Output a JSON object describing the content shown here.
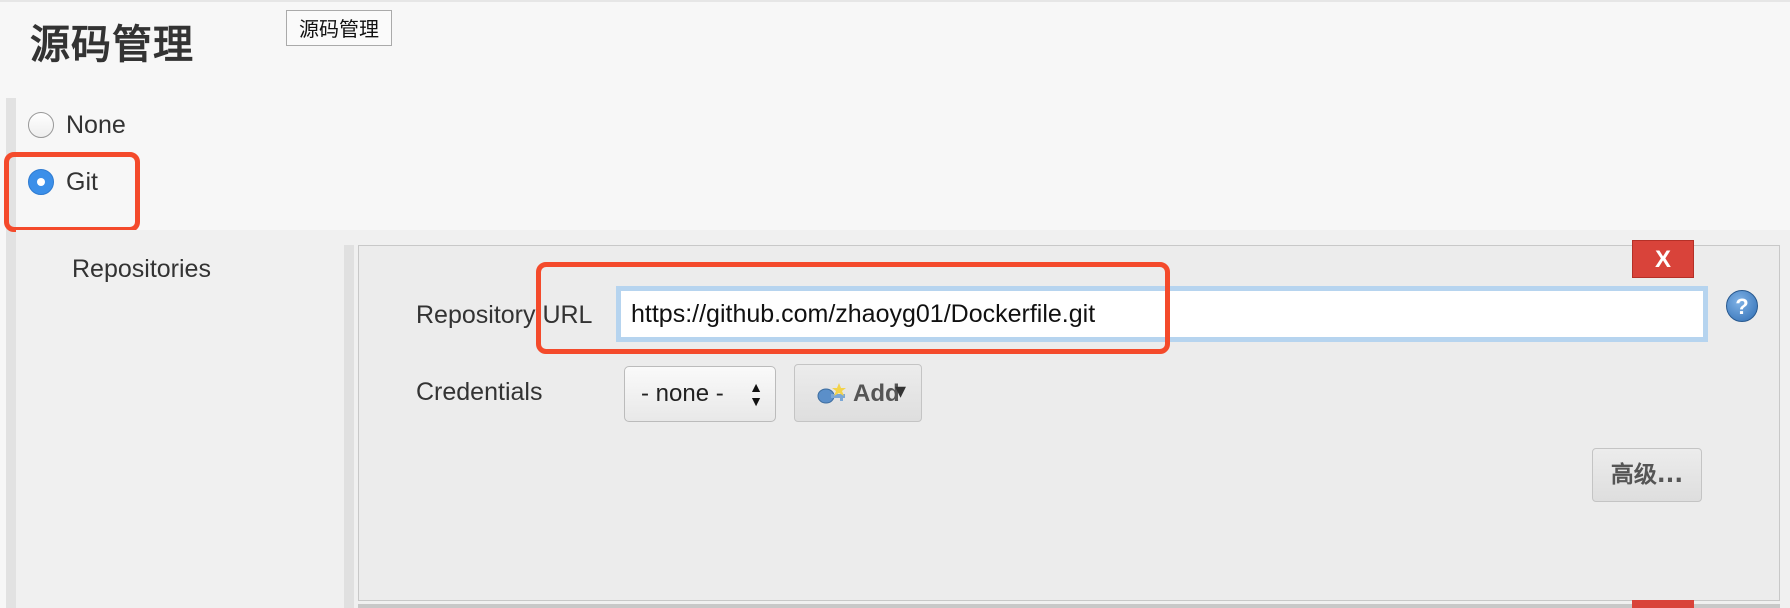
{
  "section": {
    "title": "源码管理",
    "tooltip": "源码管理"
  },
  "scm_options": [
    {
      "label": "None",
      "selected": false
    },
    {
      "label": "Git",
      "selected": true
    }
  ],
  "git": {
    "repositories_label": "Repositories",
    "delete_label": "X",
    "repository_url": {
      "label": "Repository URL",
      "value": "https://github.com/zhaoyg01/Dockerfile.git"
    },
    "credentials": {
      "label": "Credentials",
      "selected": "- none -",
      "add_label": "Add"
    },
    "advanced_label": "高级...",
    "help_label": "?"
  },
  "colors": {
    "highlight": "#f44a2b",
    "delete": "#d9433a",
    "radio_selected": "#3b8fe9"
  },
  "icons": [
    "help-icon",
    "key-icon",
    "select-arrows-icon",
    "dropdown-arrow-icon"
  ]
}
